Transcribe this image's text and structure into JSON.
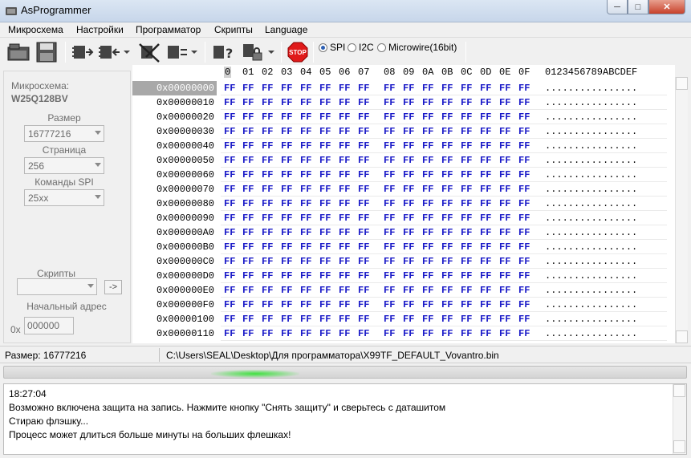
{
  "window": {
    "title": "AsProgrammer",
    "min": "─",
    "max": "□",
    "close": "✕"
  },
  "menu": [
    "Микросхема",
    "Настройки",
    "Программатор",
    "Скрипты",
    "Language"
  ],
  "toolbar": {
    "stop_label": "STOP",
    "protocols": [
      {
        "label": "SPI",
        "selected": true
      },
      {
        "label": "I2C",
        "selected": false
      },
      {
        "label": "Microwire(16bit)",
        "selected": false
      }
    ]
  },
  "left_panel": {
    "chip_label": "Микросхема:",
    "chip_name": "W25Q128BV",
    "size_label": "Размер",
    "size_value": "16777216",
    "page_label": "Страница",
    "page_value": "256",
    "spi_commands_label": "Команды SPI",
    "spi_commands_value": "25xx",
    "scripts_label": "Скрипты",
    "scripts_value": "",
    "run_script_button": "->",
    "start_address_label": "Начальный адрес",
    "address_prefix": "0x",
    "start_address_value": "000000"
  },
  "hex": {
    "columns": [
      "0",
      "01",
      "02",
      "03",
      "04",
      "05",
      "06",
      "07",
      "08",
      "09",
      "0A",
      "0B",
      "0C",
      "0D",
      "0E",
      "0F"
    ],
    "ascii_header": "0123456789ABCDEF",
    "rows": [
      "0x00000000",
      "0x00000010",
      "0x00000020",
      "0x00000030",
      "0x00000040",
      "0x00000050",
      "0x00000060",
      "0x00000070",
      "0x00000080",
      "0x00000090",
      "0x000000A0",
      "0x000000B0",
      "0x000000C0",
      "0x000000D0",
      "0x000000E0",
      "0x000000F0",
      "0x00000100",
      "0x00000110"
    ],
    "byte_value": "FF",
    "ascii_value": "................",
    "selected_row": 0
  },
  "status": {
    "size": "Размер: 16777216",
    "file_path": "C:\\Users\\SEAL\\Desktop\\Для программатора\\X99TF_DEFAULT_Vovantro.bin"
  },
  "log": [
    "18:27:04",
    "Возможно включена защита на запись. Нажмите кнопку \"Снять защиту\" и сверьтесь с даташитом",
    "Стираю флэшку...",
    "Процесс может длиться больше минуты на больших флешках!"
  ]
}
